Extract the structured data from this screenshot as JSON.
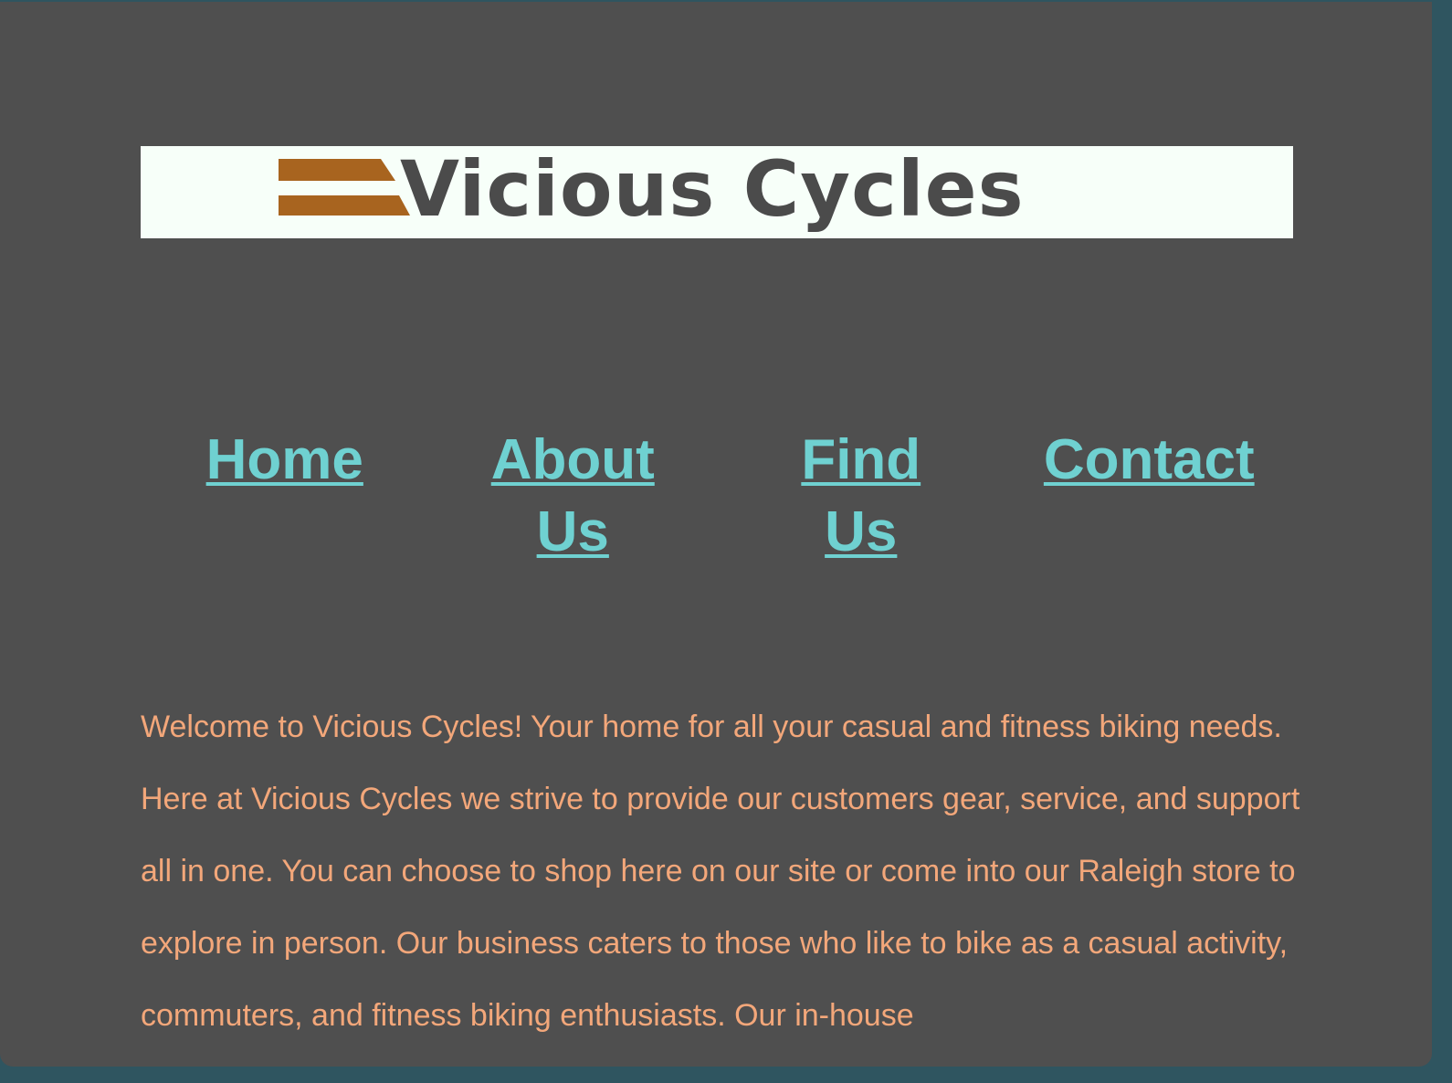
{
  "logo": {
    "text": "Vicious Cycles",
    "accent_color": "#a8641f",
    "text_color": "#4b4b4b"
  },
  "nav": {
    "items": [
      {
        "label": "Home"
      },
      {
        "label": "About Us"
      },
      {
        "label": "Find Us"
      },
      {
        "label": "Contact"
      }
    ],
    "link_color": "#6fd1d1"
  },
  "intro": {
    "text": "Welcome to Vicious Cycles! Your home for all your casual and fitness biking needs. Here at Vicious Cycles we strive to provide our customers gear, service, and support all in one. You can choose to shop here on our site or come into our Raleigh store to explore in person. Our business caters to those who like to bike as a casual activity, commuters, and fitness biking enthusiasts. Our in-house",
    "text_color": "#f3a77a"
  },
  "page": {
    "background": "#4f4f4f"
  }
}
